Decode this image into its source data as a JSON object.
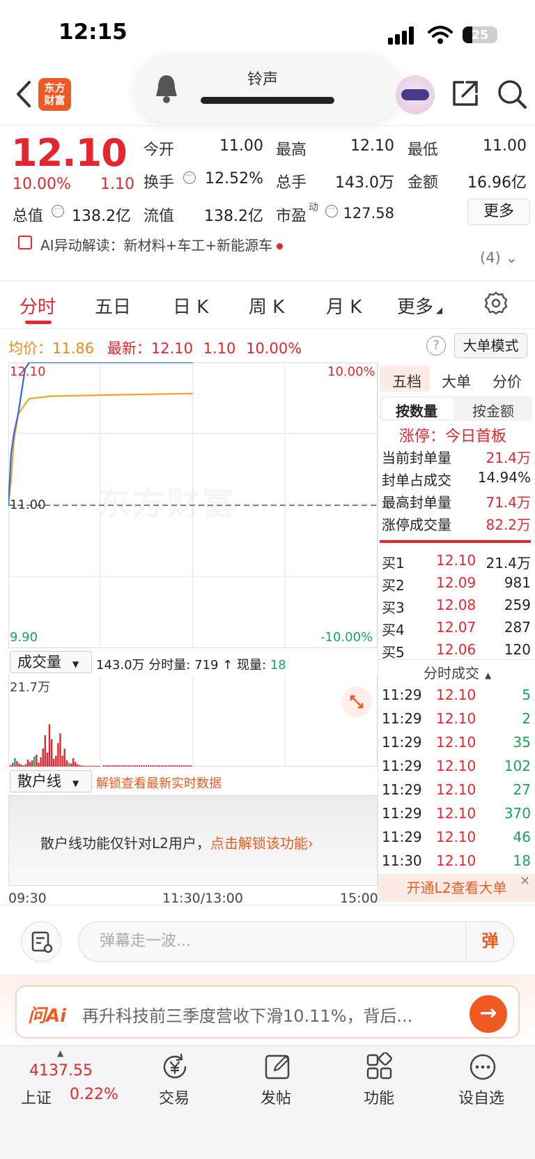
{
  "status_bar": {
    "time": "12:15",
    "battery": "25"
  },
  "header": {
    "logo_text": "东方财富",
    "ringtone_label": "铃声"
  },
  "quote": {
    "price": "12.10",
    "change_pct": "10.00%",
    "change": "1.10",
    "fields": [
      {
        "label": "今开",
        "value": "11.00",
        "value_color": "#222222"
      },
      {
        "label": "最高",
        "value": "12.10",
        "value_color": "#e5262f"
      },
      {
        "label": "最低",
        "value": "11.00",
        "value_color": "#222222"
      },
      {
        "label": "换手",
        "value": "12.52%",
        "value_color": "#222222"
      },
      {
        "label": "总手",
        "value": "143.0万",
        "value_color": "#222222"
      },
      {
        "label": "金额",
        "value": "16.96亿",
        "value_color": "#222222"
      },
      {
        "label": "总值",
        "value": "138.2亿",
        "value_color": "#222222"
      },
      {
        "label": "流值",
        "value": "138.2亿",
        "value_color": "#222222"
      },
      {
        "label": "市盈",
        "value": "127.58",
        "value_color": "#222222"
      }
    ],
    "pe_superscript": "动",
    "more_label": "更多"
  },
  "ai_bar": {
    "text": "AI异动解读：新材料+车工+新能源车",
    "count": "(4)"
  },
  "tabs": [
    "分时",
    "五日",
    "日 K",
    "周 K",
    "月 K",
    "更多"
  ],
  "summary": {
    "avg_label": "均价：",
    "avg_value": "11.86",
    "latest_label": "最新：",
    "latest_value": "12.10",
    "latest_change": "1.10",
    "latest_pct": "10.00%",
    "help": "?",
    "big_order_mode": "大单模式"
  },
  "chart_labels": {
    "top_price": "12.10",
    "top_pct": "10.00%",
    "mid_price": "11.00",
    "bottom_price": "9.90",
    "bottom_pct": "-10.00%",
    "watermark": "东方财富"
  },
  "volume": {
    "dropdown": "成交量",
    "total": "143.0万",
    "fenshi_label": "分时量:",
    "fenshi_value": "719",
    "arrow": "↑",
    "current_label": "现量:",
    "current_value": "18",
    "max_label": "21.7万"
  },
  "retail": {
    "dropdown": "散户线",
    "unlock_text": "解锁查看最新实时数据",
    "msg": "散户线功能仅针对L2用户，",
    "msg_link": "点击解锁该功能",
    "msg_arrow": "›"
  },
  "time_axis": [
    "09:30",
    "11:30/13:00",
    "15:00"
  ],
  "right_panel": {
    "tabs": [
      "五档",
      "大单",
      "分价"
    ],
    "segment": [
      "按数量",
      "按金额"
    ],
    "limit_status": "涨停：今日首板",
    "limit_stats": [
      {
        "label": "当前封单量",
        "value": "21.4万"
      },
      {
        "label": "封单占成交",
        "value": "14.94%"
      },
      {
        "label": "最高封单量",
        "value": "71.4万"
      },
      {
        "label": "涨停成交量",
        "value": "82.2万"
      }
    ],
    "bids": [
      {
        "label": "买1",
        "price": "12.10",
        "volume": "21.4万"
      },
      {
        "label": "买2",
        "price": "12.09",
        "volume": "981"
      },
      {
        "label": "买3",
        "price": "12.08",
        "volume": "259"
      },
      {
        "label": "买4",
        "price": "12.07",
        "volume": "287"
      },
      {
        "label": "买5",
        "price": "12.06",
        "volume": "120"
      }
    ],
    "ticks_header": "分时成交",
    "ticks": [
      {
        "time": "11:29",
        "price": "12.10",
        "volume": "5"
      },
      {
        "time": "11:29",
        "price": "12.10",
        "volume": "2"
      },
      {
        "time": "11:29",
        "price": "12.10",
        "volume": "35"
      },
      {
        "time": "11:29",
        "price": "12.10",
        "volume": "102"
      },
      {
        "time": "11:29",
        "price": "12.10",
        "volume": "27"
      },
      {
        "time": "11:29",
        "price": "12.10",
        "volume": "370"
      },
      {
        "time": "11:29",
        "price": "12.10",
        "volume": "46"
      },
      {
        "time": "11:30",
        "price": "12.10",
        "volume": "18"
      }
    ],
    "l2_banner": "开通L2查看大单"
  },
  "comment": {
    "placeholder": "弹幕走一波...",
    "danmu_btn": "弹"
  },
  "ask_ai": {
    "logo": "问Ai",
    "text": "再升科技前三季度营收下滑10.11%，背后..."
  },
  "bottom_nav": {
    "index_value": "4137.55",
    "index_name": "上证",
    "index_pct": "0.22%",
    "items": [
      {
        "label": "交易",
        "icon": "yen-cycle-icon"
      },
      {
        "label": "发帖",
        "icon": "edit-icon"
      },
      {
        "label": "功能",
        "icon": "grid-icon"
      },
      {
        "label": "设自选",
        "icon": "more-dots-icon"
      }
    ]
  },
  "colors": {
    "up": "#e5262f",
    "down": "#19a55a",
    "accent": "#f05a22",
    "avg_line": "#f2a12a",
    "price_line": "#2d6bd8"
  },
  "chart_data": [
    {
      "type": "line",
      "series": [
        {
          "values": [
            11.0,
            11.4,
            11.55,
            11.7,
            12.05,
            12.1,
            12.1,
            12.1,
            12.1
          ]
        },
        {
          "values": [
            11.0,
            11.2,
            11.5,
            11.7,
            11.78,
            11.82,
            11.84,
            11.85,
            11.86
          ]
        }
      ],
      "ylim": [
        9.9,
        12.1
      ]
    },
    {
      "type": "bar",
      "values": [
        4,
        10,
        22,
        14,
        8,
        5,
        3,
        6,
        18,
        12,
        16,
        26,
        30,
        10,
        24,
        46,
        80,
        36,
        108,
        70,
        20,
        28,
        60,
        85,
        28,
        46,
        16,
        10,
        8,
        22,
        12,
        6,
        4,
        3,
        2,
        2,
        2,
        2,
        2,
        1,
        1,
        1
      ],
      "ylim": [
        0,
        217
      ]
    }
  ]
}
